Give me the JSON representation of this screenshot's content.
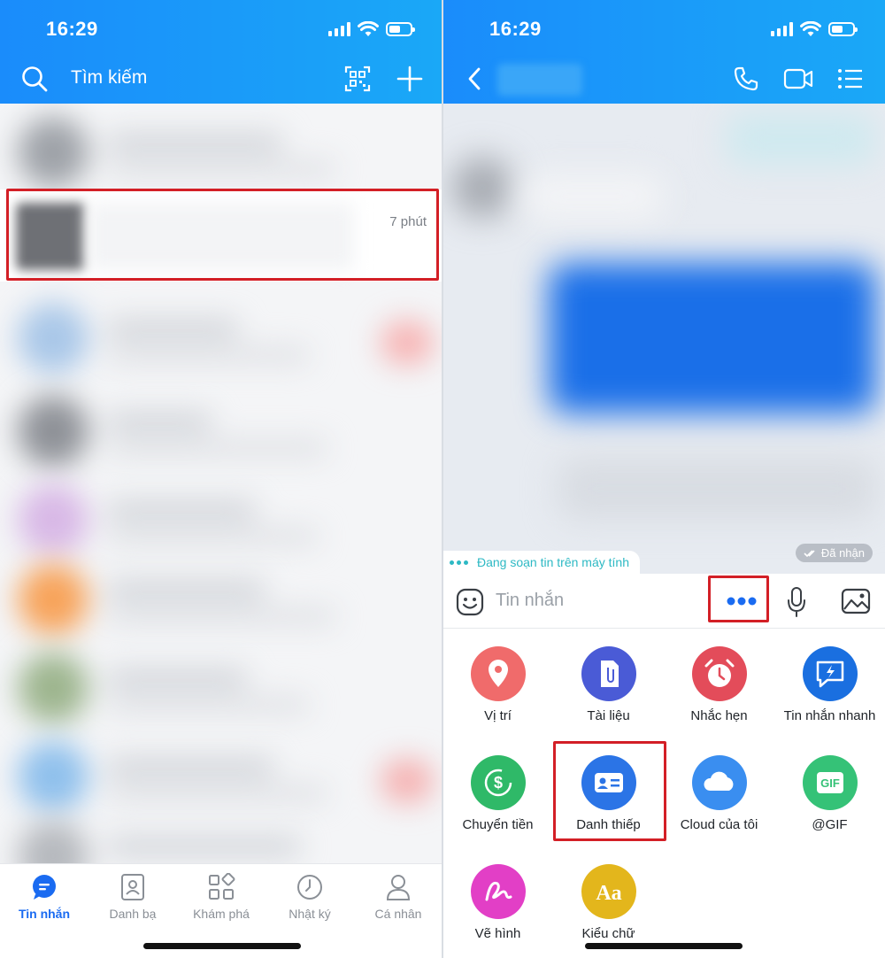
{
  "left": {
    "status_time": "16:29",
    "search_label": "Tìm kiếm",
    "highlight_time": "7 phút",
    "nav": [
      {
        "label": "Tin nhắn",
        "icon": "chat-bubble-icon",
        "active": true
      },
      {
        "label": "Danh bạ",
        "icon": "contacts-icon",
        "active": false
      },
      {
        "label": "Khám phá",
        "icon": "grid-discover-icon",
        "active": false
      },
      {
        "label": "Nhật ký",
        "icon": "clock-icon",
        "active": false
      },
      {
        "label": "Cá nhân",
        "icon": "person-icon",
        "active": false
      }
    ]
  },
  "right": {
    "status_time": "16:29",
    "typing_text": "Đang soạn tin trên máy tính",
    "received_text": "Đã nhận",
    "compose_placeholder": "Tin nhắn",
    "grid": [
      {
        "label": "Vị trí",
        "icon": "location-pin-icon",
        "color": "#f06b6b"
      },
      {
        "label": "Tài liệu",
        "icon": "document-icon",
        "color": "#4a5bd6"
      },
      {
        "label": "Nhắc hẹn",
        "icon": "alarm-clock-icon",
        "color": "#e34c5a"
      },
      {
        "label": "Tin nhắn nhanh",
        "icon": "quick-message-icon",
        "color": "#1a6fe0"
      },
      {
        "label": "Chuyển tiền",
        "icon": "money-transfer-icon",
        "color": "#2fb968"
      },
      {
        "label": "Danh thiếp",
        "icon": "business-card-icon",
        "color": "#2b74e6"
      },
      {
        "label": "Cloud của tôi",
        "icon": "cloud-icon",
        "color": "#3a8ef0"
      },
      {
        "label": "@GIF",
        "icon": "gif-icon",
        "color": "#35c277"
      },
      {
        "label": "Vẽ hình",
        "icon": "draw-icon",
        "color": "#e23fc6"
      },
      {
        "label": "Kiểu chữ",
        "icon": "font-style-icon",
        "color": "#e3b61c"
      }
    ]
  },
  "colors": {
    "header": "#1a96fa",
    "highlight": "#d31f26",
    "active_nav": "#1a6bf1"
  }
}
